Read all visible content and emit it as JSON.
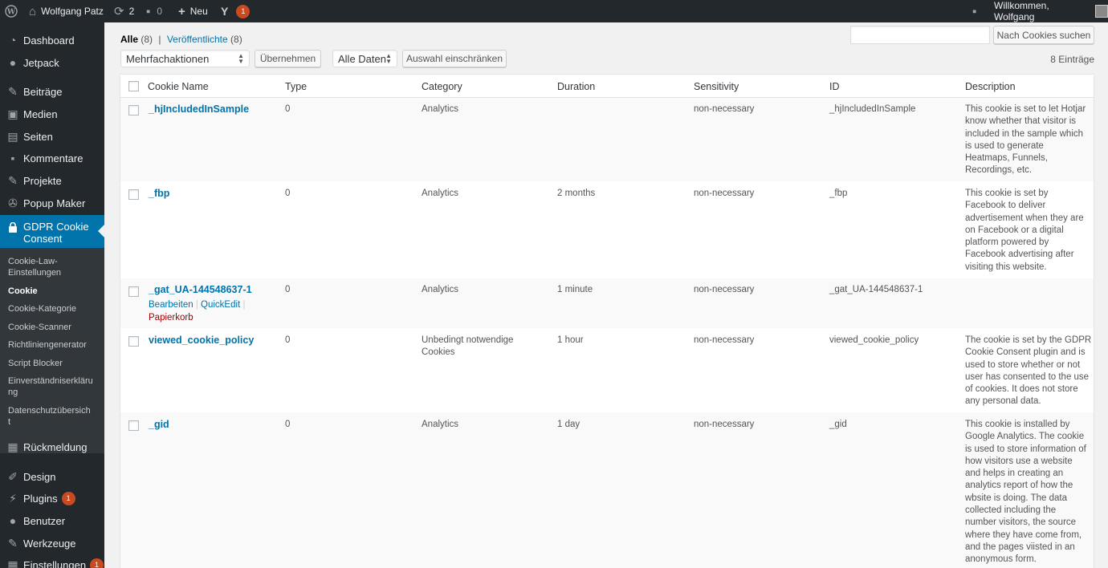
{
  "adminbar": {
    "site_name": "Wolfgang Patz",
    "updates_count": "2",
    "comments_count": "0",
    "new_label": "Neu",
    "yoast_badge": "1",
    "greeting": "Willkommen, Wolfgang"
  },
  "sidebar": {
    "dashboard": "Dashboard",
    "jetpack": "Jetpack",
    "posts": "Beiträge",
    "media": "Medien",
    "pages": "Seiten",
    "comments": "Kommentare",
    "projects": "Projekte",
    "popup_maker": "Popup Maker",
    "gdpr_line1": "GDPR Cookie",
    "gdpr_line2": "Consent",
    "submenu": {
      "law_settings_1": "Cookie-Law-",
      "law_settings_2": "Einstellungen",
      "cookie": "Cookie",
      "category": "Cookie-Kategorie",
      "scanner": "Cookie-Scanner",
      "policy_generator": "Richtliniengenerator",
      "script_blocker": "Script Blocker",
      "consent_1": "Einverständniserkläru",
      "consent_2": "ng",
      "privacy_1": "Datenschutzübersich",
      "privacy_2": "t"
    },
    "feedback": "Rückmeldung",
    "design": "Design",
    "plugins": "Plugins",
    "plugins_badge": "1",
    "users": "Benutzer",
    "tools": "Werkzeuge",
    "settings": "Einstellungen",
    "settings_badge": "1"
  },
  "filters": {
    "all_label": "Alle",
    "all_count": "(8)",
    "sep": "|",
    "published_label": "Veröffentlichte",
    "published_count": "(8)"
  },
  "toolbar": {
    "bulk_select": "Mehrfachaktionen",
    "apply_button": "Übernehmen",
    "date_select": "Alle Daten",
    "filter_button": "Auswahl einschränken",
    "items_count": "8 Einträge",
    "search_button": "Nach Cookies suchen",
    "search_value": ""
  },
  "table": {
    "columns": [
      "Cookie Name",
      "Type",
      "Category",
      "Duration",
      "Sensitivity",
      "ID",
      "Description"
    ],
    "row_actions": {
      "edit": "Bearbeiten",
      "quickedit": "QuickEdit",
      "sep": "|",
      "trash": "Papierkorb"
    },
    "rows": [
      {
        "name": "_hjIncludedInSample",
        "type": "0",
        "category": "Analytics",
        "duration": "",
        "sensitivity": "non-necessary",
        "id": "_hjIncludedInSample",
        "description": [
          "This cookie is set to let Hotjar",
          "know whether that visitor is",
          "included in the sample which",
          "is used to generate",
          "Heatmaps, Funnels,",
          "Recordings, etc."
        ]
      },
      {
        "name": "_fbp",
        "type": "0",
        "category": "Analytics",
        "duration": "2 months",
        "sensitivity": "non-necessary",
        "id": "_fbp",
        "description": [
          "This cookie is set by",
          "Facebook to deliver",
          "advertisement when they are",
          "on Facebook or a digital",
          "platform powered by",
          "Facebook advertising after",
          "visiting this website."
        ]
      },
      {
        "name": "_gat_UA-144548637-1",
        "type": "0",
        "category": "Analytics",
        "duration": "1 minute",
        "sensitivity": "non-necessary",
        "id": "_gat_UA-144548637-1",
        "description": []
      },
      {
        "name": "viewed_cookie_policy",
        "type": "0",
        "category": [
          "Unbedingt notwendige",
          "Cookies"
        ],
        "duration": "1 hour",
        "sensitivity": "non-necessary",
        "id": "viewed_cookie_policy",
        "description": [
          "The cookie is set by the GDPR",
          "Cookie Consent plugin and is",
          "used to store whether or not",
          "user has consented to the use",
          "of cookies. It does not store",
          "any personal data."
        ]
      },
      {
        "name": "_gid",
        "type": "0",
        "category": "Analytics",
        "duration": "1 day",
        "sensitivity": "non-necessary",
        "id": "_gid",
        "description": [
          "This cookie is installed by",
          "Google Analytics. The cookie",
          "is used to store information of",
          "how visitors use a website",
          "and helps in creating an",
          "analytics report of how the",
          "wbsite is doing. The data",
          "collected including the",
          "number visitors, the source",
          "where they have come from,",
          "and the pages viisted in an",
          "anonymous form."
        ]
      }
    ]
  },
  "colors": {
    "accent": "#0073aa",
    "sidebar": "#23282d",
    "badge": "#ca4a1f",
    "trash": "#aa0000"
  }
}
